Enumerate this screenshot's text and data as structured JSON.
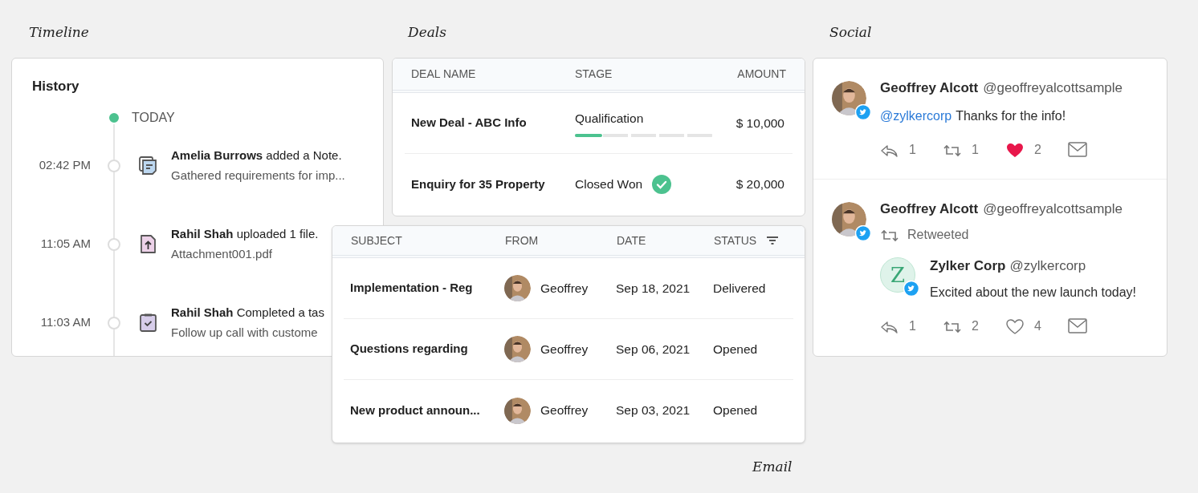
{
  "timeline": {
    "label": "Timeline",
    "title": "History",
    "day": "TODAY",
    "items": [
      {
        "kind": "note",
        "time": "02:42 PM",
        "actor": "Amelia Burrows",
        "action": "added a Note.",
        "detail": "Gathered requirements for imp..."
      },
      {
        "kind": "file",
        "time": "11:05 AM",
        "actor": "Rahil Shah",
        "action": "uploaded 1 file.",
        "detail": "Attachment001.pdf"
      },
      {
        "kind": "task",
        "time": "11:03 AM",
        "actor": "Rahil Shah",
        "action": "Completed a tas",
        "detail": "Follow up call with custome"
      }
    ]
  },
  "deals": {
    "label": "Deals",
    "columns": [
      "DEAL NAME",
      "STAGE",
      "AMOUNT"
    ],
    "rows": [
      {
        "name": "New Deal - ABC Info",
        "stage": "Qualification",
        "kind": "progress",
        "level": 0.2,
        "amount": "$ 10,000"
      },
      {
        "name": "Enquiry for 35 Property",
        "stage": "Closed Won",
        "kind": "won",
        "amount": "$ 20,000"
      }
    ]
  },
  "email": {
    "label": "Email",
    "columns": [
      "SUBJECT",
      "FROM",
      "DATE",
      "STATUS"
    ],
    "rows": [
      {
        "subject": "Implementation - Reg",
        "from": "Geoffrey",
        "date": "Sep 18, 2021",
        "status": "Delivered"
      },
      {
        "subject": "Questions regarding",
        "from": "Geoffrey",
        "date": "Sep 06, 2021",
        "status": "Opened"
      },
      {
        "subject": "New product announ...",
        "from": "Geoffrey",
        "date": "Sep 03, 2021",
        "status": "Opened"
      }
    ]
  },
  "social": {
    "label": "Social",
    "posts": [
      {
        "kind": "tweet",
        "name": "Geoffrey Alcott",
        "handle": "@geoffreyalcottsample",
        "mention": "@zylkercorp",
        "text": "Thanks for the info!",
        "replies": "1",
        "retweets": "1",
        "likes": "2",
        "liked": true
      },
      {
        "kind": "retweet",
        "name": "Geoffrey Alcott",
        "handle": "@geoffreyalcottsample",
        "note": "Retweeted",
        "quoted": {
          "initial": "Z",
          "name": "Zylker Corp",
          "handle": "@zylkercorp",
          "text": "Excited about the new launch today!"
        },
        "replies": "1",
        "retweets": "2",
        "likes": "4",
        "liked": false
      }
    ]
  }
}
